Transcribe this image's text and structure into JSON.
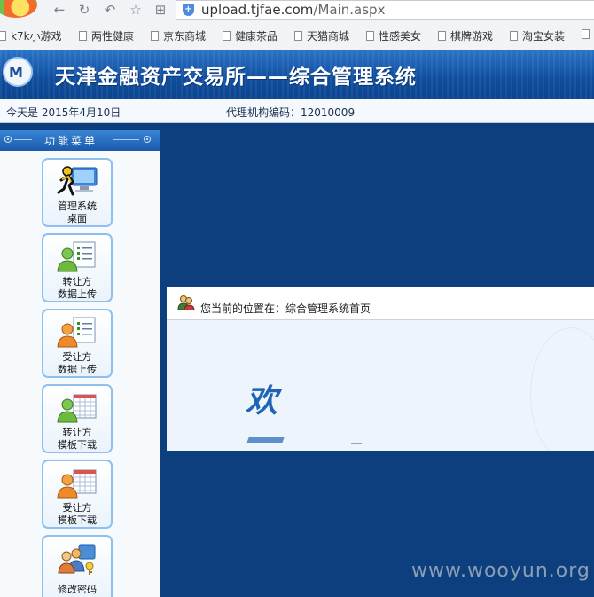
{
  "browser": {
    "url_main": "upload.tjfae.com",
    "url_path": "/Main.aspx",
    "bookmarks": [
      "k7k小游戏",
      "两性健康",
      "京东商城",
      "健康茶品",
      "天猫商城",
      "性感美女",
      "棋牌游戏",
      "淘宝女装"
    ]
  },
  "app": {
    "title": "天津金融资产交易所——综合管理系统",
    "date_text": "今天是 2015年4月10日",
    "agency_text": "代理机构编码：12010009"
  },
  "sidebar": {
    "header": "功能菜单",
    "items": [
      {
        "line1": "管理系统",
        "line2": "桌面",
        "icon": "desktop-user-icon"
      },
      {
        "line1": "转让方",
        "line2": "数据上传",
        "icon": "green-user-list-icon"
      },
      {
        "line1": "受让方",
        "line2": "数据上传",
        "icon": "orange-user-list-icon"
      },
      {
        "line1": "转让方",
        "line2": "模板下载",
        "icon": "green-user-grid-icon"
      },
      {
        "line1": "受让方",
        "line2": "模板下载",
        "icon": "orange-user-grid-icon"
      },
      {
        "line1": "修改密码",
        "line2": "",
        "icon": "users-key-icon"
      }
    ]
  },
  "content": {
    "location": "您当前的位置在：综合管理系统首页",
    "welcome_char": "欢"
  },
  "watermark": "www.wooyun.org",
  "colors": {
    "background": "#0d3f7f",
    "banner": "#1a5aad",
    "menu_border": "#8ec0ef",
    "welcome": "#1e64b4"
  }
}
